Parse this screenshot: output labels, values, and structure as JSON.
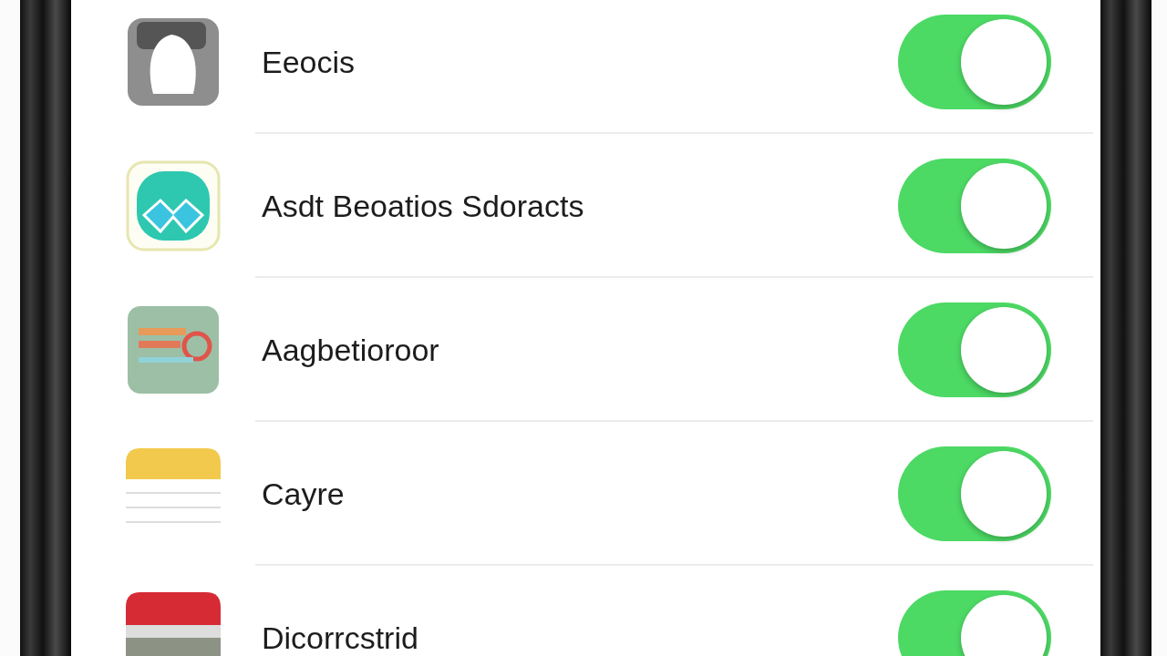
{
  "rows": [
    {
      "label": "Eeocis",
      "on": true
    },
    {
      "label": "Asdt Beoatios Sdoracts",
      "on": true
    },
    {
      "label": "Aagbetioroor",
      "on": true
    },
    {
      "label": "Cayre",
      "on": true
    },
    {
      "label": "Dicorrcstrid",
      "on": true
    }
  ]
}
